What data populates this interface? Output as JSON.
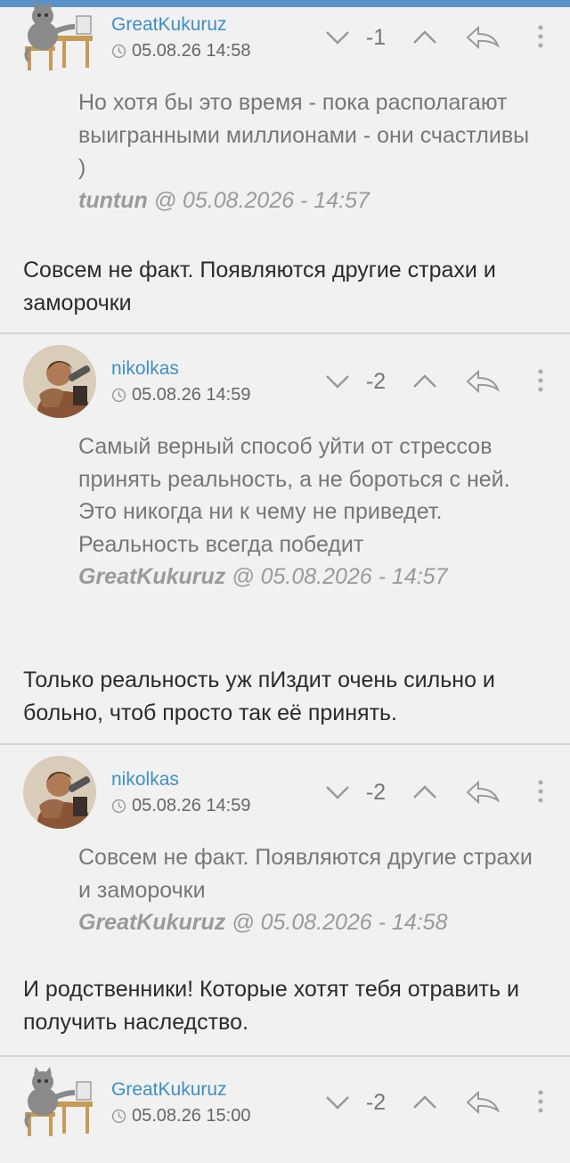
{
  "comments": [
    {
      "author": "GreatKukuruz",
      "time": "05.08.26 14:58",
      "score": "-1",
      "avatar": "cat-avatar",
      "quote": "Но хотя бы это время - пока располагают выигранными миллионами - они счастливы )",
      "quote_author": "tuntun",
      "quote_date": "@ 05.08.2026 - 14:57",
      "reply": "Совсем не факт. Появляются другие страхи и заморочки"
    },
    {
      "author": "nikolkas",
      "time": "05.08.26 14:59",
      "score": "-2",
      "avatar": "photo-avatar",
      "quote": "Самый верный способ уйти от стрессов принять реальность, а не бороться с ней. Это никогда ни к чему не приведет. Реальность всегда победит",
      "quote_author": "GreatKukuruz",
      "quote_date": "@ 05.08.2026 - 14:57",
      "reply": "Только реальность уж пИздит очень сильно и больно, чтоб просто так её принять."
    },
    {
      "author": "nikolkas",
      "time": "05.08.26 14:59",
      "score": "-2",
      "avatar": "photo-avatar",
      "quote": "Совсем не факт. Появляются другие страхи и заморочки",
      "quote_author": "GreatKukuruz",
      "quote_date": "@ 05.08.2026 - 14:58",
      "reply": "И родственники! Которые хотят тебя отравить и получить наследство."
    },
    {
      "author": "GreatKukuruz",
      "time": "05.08.26 15:00",
      "score": "-2",
      "avatar": "cat-avatar"
    }
  ],
  "icons": [
    "downvote-chevron-icon",
    "upvote-chevron-icon",
    "reply-arrow-icon",
    "more-dots-icon",
    "clock-icon"
  ],
  "colors": {
    "topbar": "#5b91c9",
    "author": "#3f8fc3",
    "background": "#f1f1f1",
    "text": "#2b2b2b",
    "quote": "#777777"
  }
}
